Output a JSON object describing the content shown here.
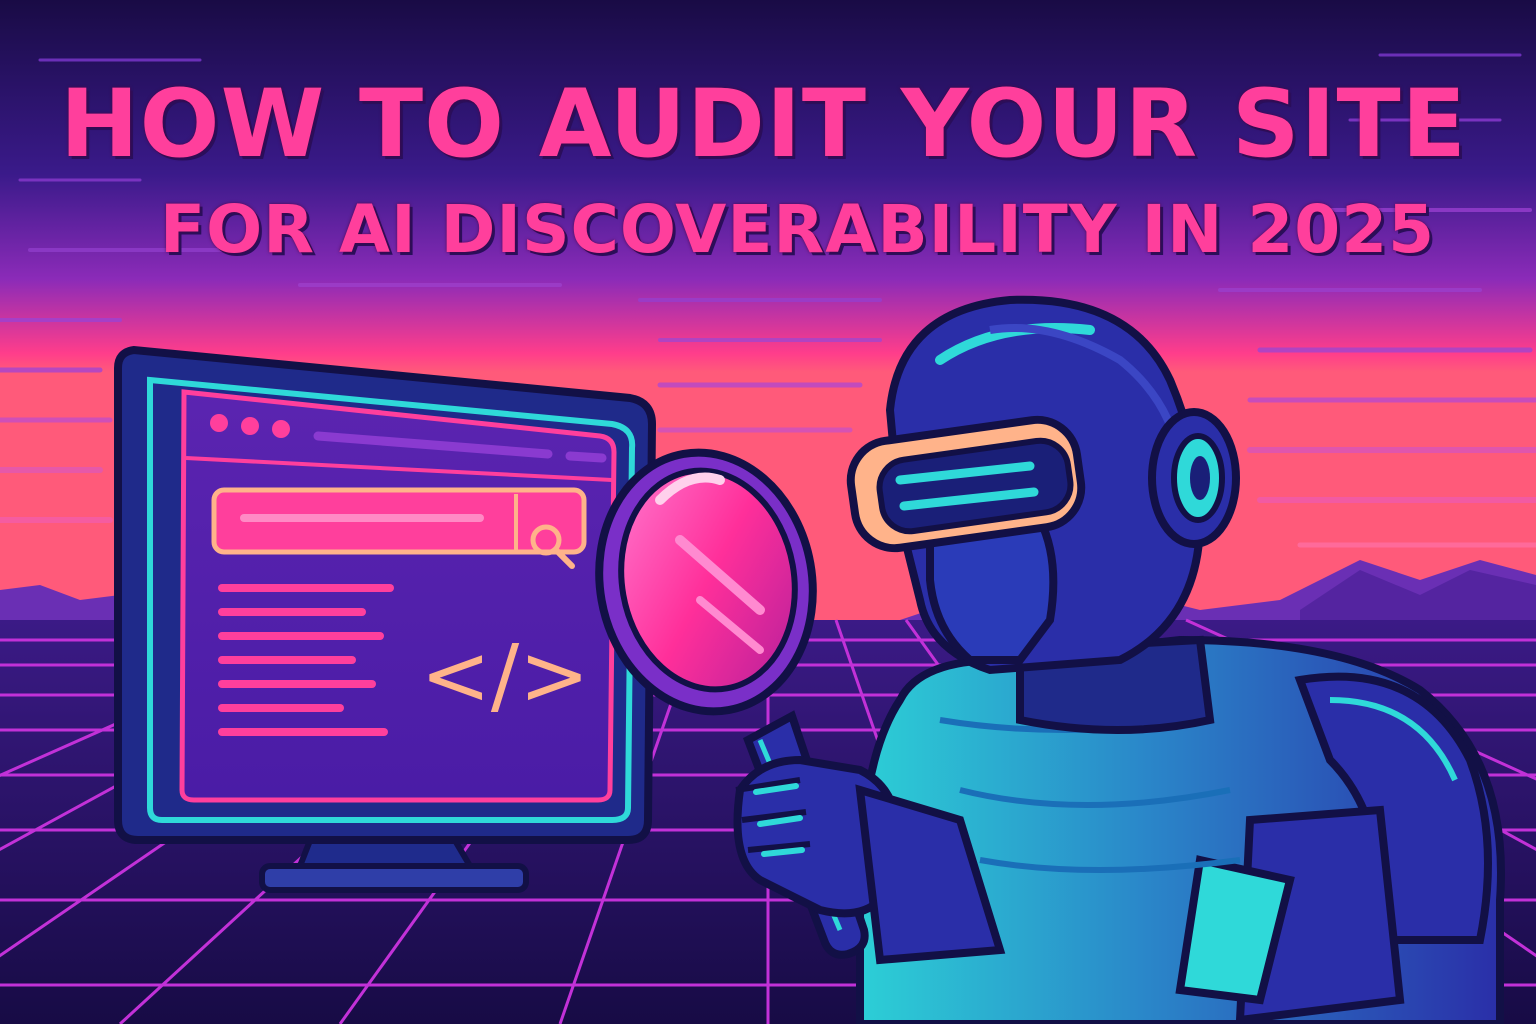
{
  "title": {
    "line1": "HOW TO AUDIT YOUR SITE",
    "line2": "FOR AI DISCOVERABILITY IN 2025"
  },
  "screen": {
    "code_symbol": "</>"
  },
  "colors": {
    "title": "#ff3f9c",
    "sky_top": "#1a0c4a",
    "sky_horizon": "#ff3d8b",
    "grid": "#c231d8",
    "cyan": "#2fd9d9",
    "robot_body": "#2a2ea8",
    "lens": "#ff3aa0"
  },
  "icons": [
    "search-icon",
    "code-icon",
    "magnifier-icon",
    "robot-icon",
    "monitor-icon"
  ]
}
